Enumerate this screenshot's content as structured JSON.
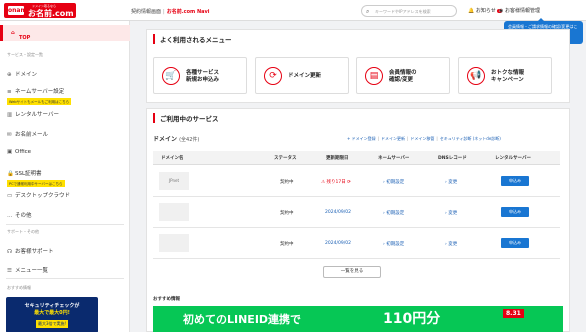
{
  "header": {
    "logo_small": "ドメイン取るなら",
    "logo": "お名前.com",
    "logo_mark": "onamae",
    "crumb_root": "契約情報画面",
    "crumb_sep": "|",
    "crumb_current": "お名前.com Navi",
    "search_placeholder": "キーワードやIPアドレスを検索",
    "notice_label": "お知らせ",
    "notice_count": "1",
    "account_label": "お客様情報管理",
    "tooltip": "会員情報・ご請求情報の確認/変更はこちら"
  },
  "sidebar": {
    "top": "TOP",
    "section1": "サービス・設定一覧",
    "items": [
      {
        "label": "ドメイン",
        "icon": "globe-icon"
      },
      {
        "label": "ネームサーバー設定",
        "icon": "server-icon"
      },
      {
        "label": "レンタルサーバー",
        "icon": "server-rack-icon"
      },
      {
        "label": "お名前メール",
        "icon": "mail-icon"
      },
      {
        "label": "Office",
        "icon": "office-icon"
      },
      {
        "label": "SSL証明書",
        "icon": "lock-icon"
      },
      {
        "label": "デスクトップクラウド",
        "icon": "desktop-icon"
      },
      {
        "label": "その他",
        "icon": "more-icon"
      }
    ],
    "tag_server": "Webサイトもメールもご利用はこちら",
    "tag_ssl": "PCで通常利用中サーバーはこちら",
    "section2": "サポート・その他",
    "support": "お客様サポート",
    "menu": "メニュー一覧",
    "section3": "おすすめ情報",
    "banner_l1": "セキュリティチェックが",
    "banner_l2": "最大で最大0円!",
    "banner_l3": "最大3倍で実施!"
  },
  "quick": {
    "title": "よく利用されるメニュー",
    "buttons": [
      {
        "line1": "各種サービス",
        "line2": "新規お申込み",
        "icon": "cart-icon",
        "glyph": "🛒"
      },
      {
        "line1": "ドメイン更新",
        "line2": "",
        "icon": "refresh-icon",
        "glyph": "⟳"
      },
      {
        "line1": "会員情報の",
        "line2": "確認/変更",
        "icon": "user-card-icon",
        "glyph": "▤"
      },
      {
        "line1": "おトクな情報",
        "line2": "キャンペーン",
        "icon": "megaphone-icon",
        "glyph": "📢"
      }
    ]
  },
  "services": {
    "title": "ご利用中のサービス",
    "domain_heading": "ドメイン",
    "domain_count": "(全42件)",
    "links": [
      "+ ドメイン登録",
      "ドメイン更新",
      "ドメイン移管",
      "セキュリティ診断 (ネットde診断)"
    ],
    "columns": [
      "ドメイン名",
      "ステータス",
      "更新期限日",
      "ネームサーバー",
      "DNSレコード",
      "レンタルサーバー"
    ],
    "rows": [
      {
        "domain": "JPnet",
        "status": "契約中",
        "expiry": "残り17日",
        "ns": "› 初期設定",
        "dns": "› 変更",
        "apply": "申込み"
      },
      {
        "domain": "",
        "status": "契約中",
        "expiry": "2024/09/02",
        "ns": "› 初期設定",
        "dns": "› 変更",
        "apply": "申込み"
      },
      {
        "domain": "",
        "status": "契約中",
        "expiry": "2024/09/02",
        "ns": "› 初期設定",
        "dns": "› 変更",
        "apply": "申込み"
      }
    ],
    "more": "一覧を見る",
    "recommend": "おすすめ情報"
  },
  "promo": {
    "text": "初めてのLINEID連携で",
    "amount": "110円分",
    "date": "8.31"
  }
}
